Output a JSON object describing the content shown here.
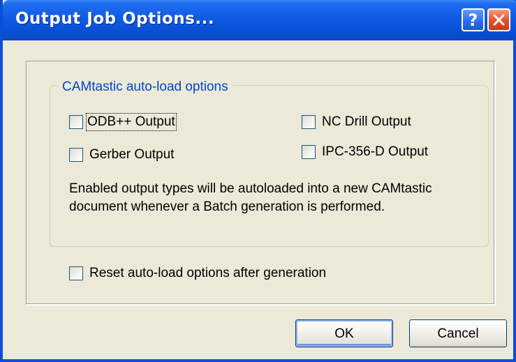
{
  "window": {
    "title": "Output Job Options...",
    "help_glyph": "?",
    "close_icon": "close-icon"
  },
  "group": {
    "legend": "CAMtastic auto-load options",
    "checkboxes": [
      {
        "label": "ODB++ Output",
        "checked": false,
        "focused": true
      },
      {
        "label": "NC Drill Output",
        "checked": false
      },
      {
        "label": "Gerber Output",
        "checked": false
      },
      {
        "label": "IPC-356-D Output",
        "checked": false
      }
    ],
    "description_line1": "Enabled output types will be autoloaded into a new CAMtastic",
    "description_line2": "document whenever a Batch generation is performed."
  },
  "reset_option": {
    "label": "Reset auto-load options after generation",
    "checked": false
  },
  "buttons": {
    "ok": "OK",
    "cancel": "Cancel"
  },
  "colors": {
    "titlebar": "#0a52d8",
    "legend_text": "#0046d5",
    "close_button": "#e0502d",
    "dialog_background": "#ece9d8"
  }
}
